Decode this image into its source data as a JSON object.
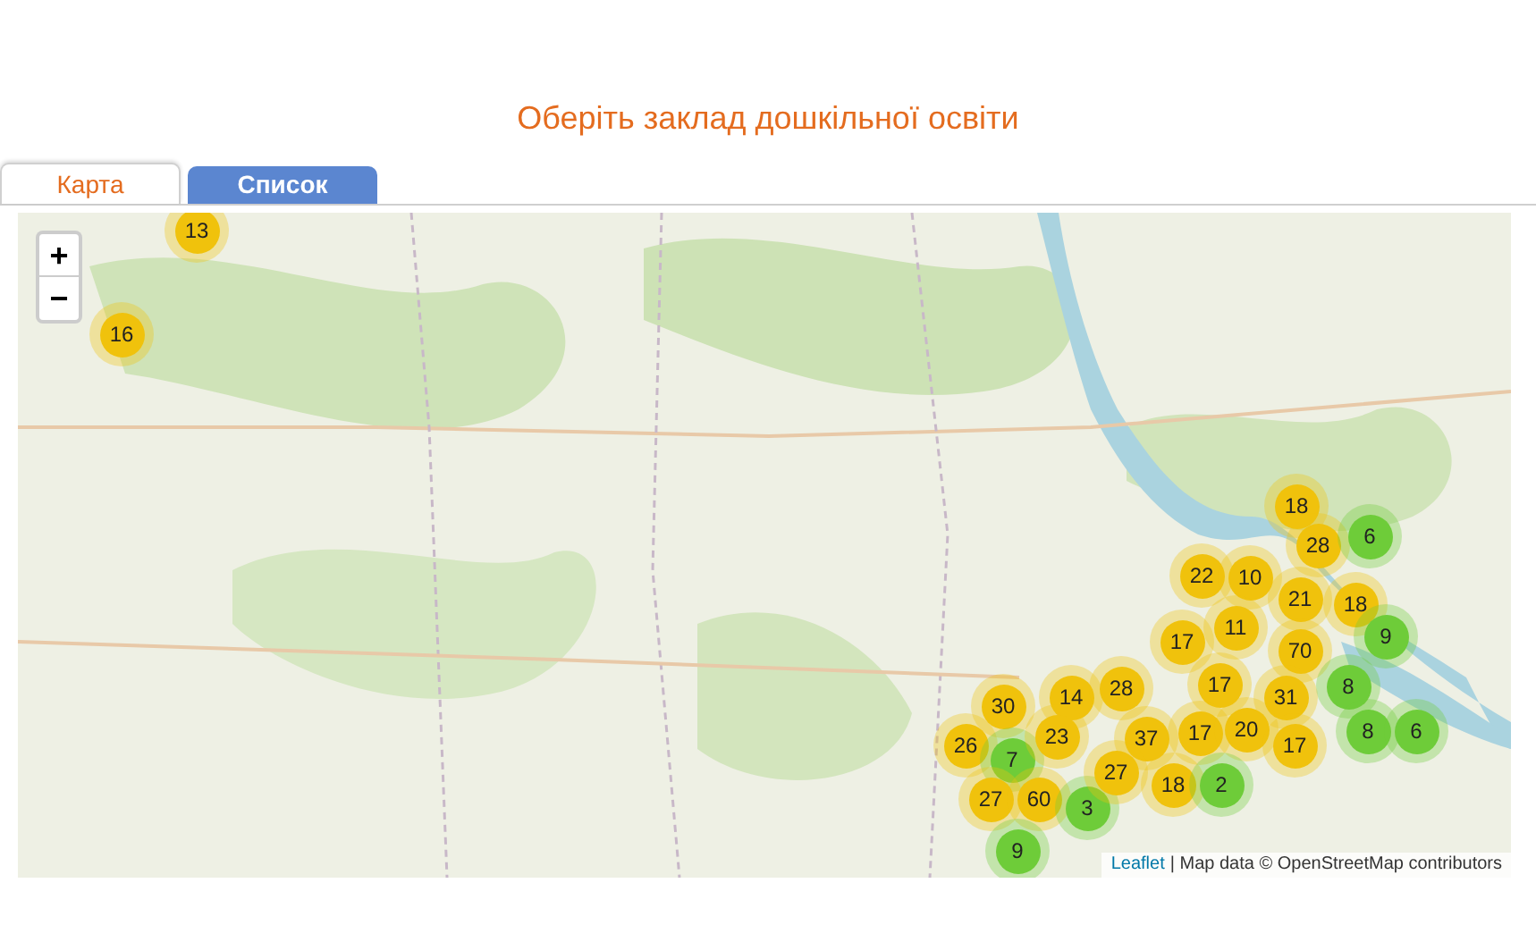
{
  "title": "Оберіть заклад дошкільної освіти",
  "tabs": [
    {
      "label": "Карта",
      "selected": true
    },
    {
      "label": "Список",
      "selected": false
    }
  ],
  "map": {
    "zoom_in": "+",
    "zoom_out": "−",
    "clusters": [
      {
        "count": "13",
        "color": "#f0c20c"
      },
      {
        "count": "16",
        "color": "#f0c20c"
      },
      {
        "count": "18",
        "color": "#f0c20c"
      },
      {
        "count": "28",
        "color": "#f0c20c"
      },
      {
        "count": "6",
        "color": "#6ecc39"
      },
      {
        "count": "22",
        "color": "#f0c20c"
      },
      {
        "count": "10",
        "color": "#f0c20c"
      },
      {
        "count": "21",
        "color": "#f0c20c"
      },
      {
        "count": "18",
        "color": "#f0c20c"
      },
      {
        "count": "17",
        "color": "#f0c20c"
      },
      {
        "count": "11",
        "color": "#f0c20c"
      },
      {
        "count": "70",
        "color": "#f0c20c"
      },
      {
        "count": "9",
        "color": "#6ecc39"
      },
      {
        "count": "30",
        "color": "#f0c20c"
      },
      {
        "count": "14",
        "color": "#f0c20c"
      },
      {
        "count": "28",
        "color": "#f0c20c"
      },
      {
        "count": "17",
        "color": "#f0c20c"
      },
      {
        "count": "31",
        "color": "#f0c20c"
      },
      {
        "count": "8",
        "color": "#6ecc39"
      },
      {
        "count": "26",
        "color": "#f0c20c"
      },
      {
        "count": "7",
        "color": "#6ecc39"
      },
      {
        "count": "23",
        "color": "#f0c20c"
      },
      {
        "count": "37",
        "color": "#f0c20c"
      },
      {
        "count": "17",
        "color": "#f0c20c"
      },
      {
        "count": "20",
        "color": "#f0c20c"
      },
      {
        "count": "17",
        "color": "#f0c20c"
      },
      {
        "count": "8",
        "color": "#6ecc39"
      },
      {
        "count": "6",
        "color": "#6ecc39"
      },
      {
        "count": "27",
        "color": "#f0c20c"
      },
      {
        "count": "60",
        "color": "#f0c20c"
      },
      {
        "count": "3",
        "color": "#6ecc39"
      },
      {
        "count": "27",
        "color": "#f0c20c"
      },
      {
        "count": "18",
        "color": "#f0c20c"
      },
      {
        "count": "2",
        "color": "#6ecc39"
      },
      {
        "count": "9",
        "color": "#6ecc39"
      }
    ],
    "attribution": {
      "link": "Leaflet",
      "text": "| Map data © OpenStreetMap contributors"
    }
  }
}
